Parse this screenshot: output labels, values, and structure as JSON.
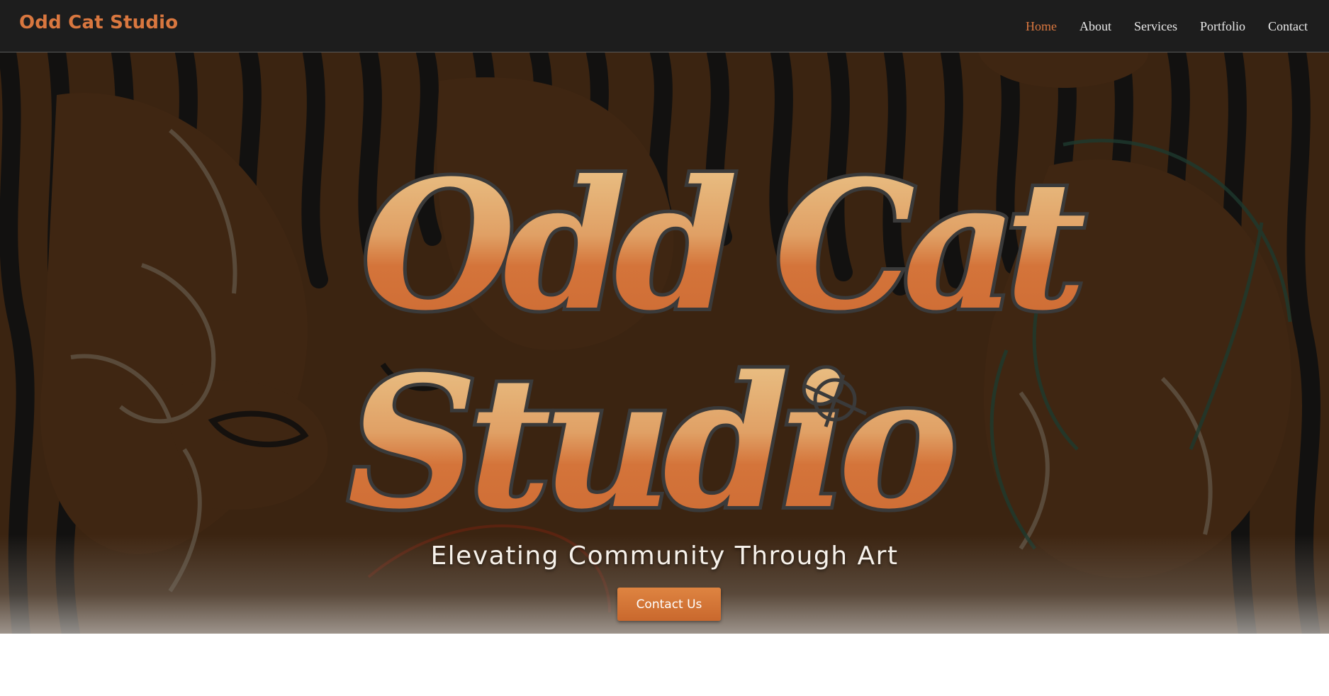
{
  "brand": {
    "name": "Odd Cat Studio"
  },
  "nav": {
    "items": [
      {
        "label": "Home",
        "active": true
      },
      {
        "label": "About",
        "active": false
      },
      {
        "label": "Services",
        "active": false
      },
      {
        "label": "Portfolio",
        "active": false
      },
      {
        "label": "Contact",
        "active": false
      }
    ]
  },
  "hero": {
    "logo_text": "Odd Cat Studio",
    "tagline": "Elevating Community Through Art",
    "cta_label": "Contact Us"
  },
  "colors": {
    "accent": "#d9773f",
    "navbar_bg": "#1d1d1d",
    "hero_brown": "#3a220f",
    "logo_light": "#e8c48a",
    "logo_dark": "#d06d35"
  }
}
